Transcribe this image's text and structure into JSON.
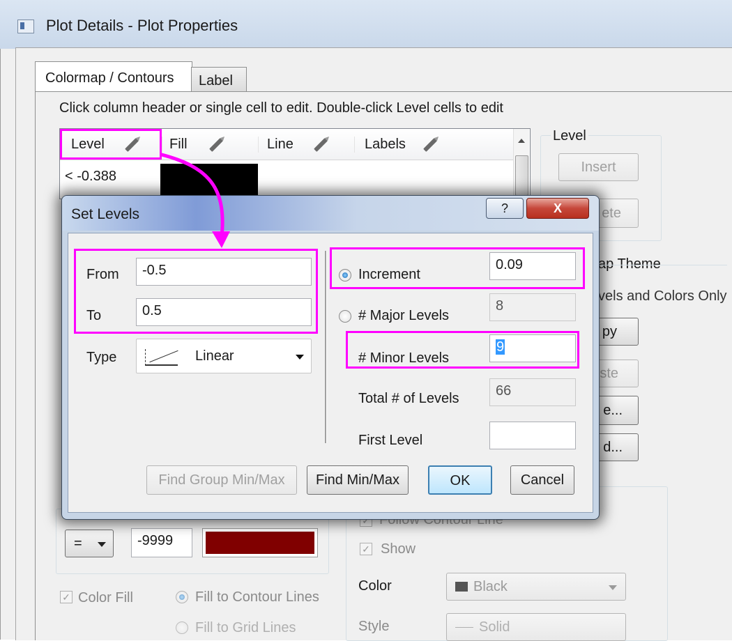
{
  "window": {
    "title": "Plot Details - Plot Properties"
  },
  "tabs": [
    {
      "label": "Colormap / Contours"
    },
    {
      "label": "Label"
    }
  ],
  "instruction": "Click column header or single cell to edit. Double-click Level cells to edit",
  "table": {
    "columns": [
      "Level",
      "Fill",
      "Line",
      "Labels"
    ],
    "first_row_level": "< -0.388"
  },
  "level_group": {
    "title": "Level",
    "insert": "Insert",
    "delete_partial": "ete"
  },
  "theme_group": {
    "title_partial": "ap Theme",
    "levels_colors_partial": "vels and Colors Only",
    "copy_partial": "py",
    "paste_partial": "ste",
    "save_partial": "e...",
    "load_partial": "d..."
  },
  "missing": {
    "operator": "=",
    "value": "-9999",
    "swatch_color": "#800000"
  },
  "fill": {
    "color_fill": "Color Fill",
    "fill_contour": "Fill to Contour Lines",
    "fill_grid": "Fill to Grid Lines"
  },
  "line": {
    "follow_partial": "Follow Contour Line",
    "show": "Show",
    "color_label": "Color",
    "color_value": "Black",
    "style_label": "Style",
    "style_value": "Solid"
  },
  "dialog": {
    "title": "Set Levels",
    "help": "?",
    "close": "X",
    "from_label": "From",
    "from_value": "-0.5",
    "to_label": "To",
    "to_value": "0.5",
    "type_label": "Type",
    "type_value": "Linear",
    "increment_label": "Increment",
    "increment_value": "0.09",
    "major_label": "# Major Levels",
    "major_value": "8",
    "minor_label": "# Minor Levels",
    "minor_value": "9",
    "total_label": "Total # of Levels",
    "total_value": "66",
    "first_label": "First Level",
    "first_value": "",
    "btn_find_group": "Find Group Min/Max",
    "btn_find": "Find Min/Max",
    "btn_ok": "OK",
    "btn_cancel": "Cancel"
  },
  "colors": {
    "highlight": "#ff00ff",
    "selection": "#3399ff",
    "missing_swatch": "#800000"
  }
}
